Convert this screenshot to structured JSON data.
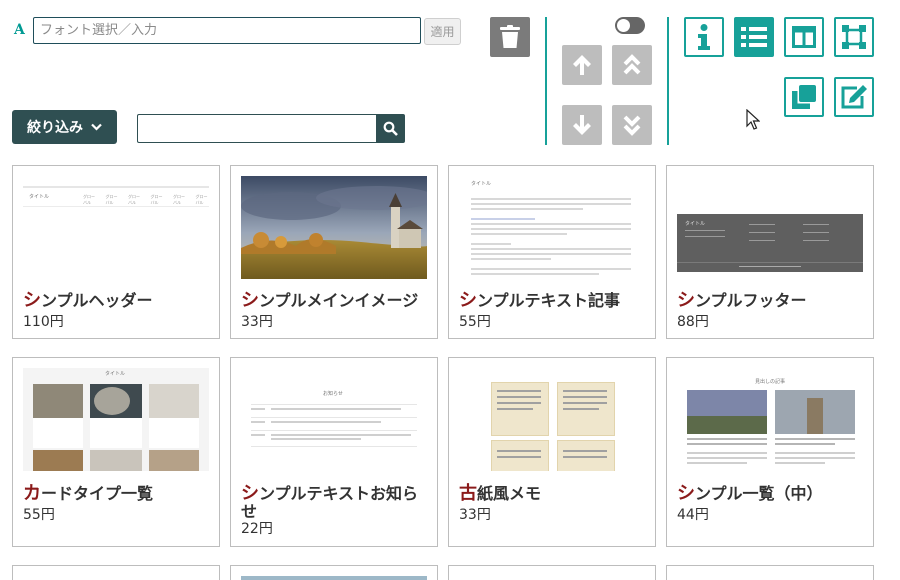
{
  "toolbar": {
    "font_icon": "A",
    "font_placeholder": "フォント選択／入力",
    "apply_label": "適用",
    "filter_label": "絞り込み",
    "search_value": ""
  },
  "icons": {
    "trash": "trash-icon",
    "up": "arrow-up-icon",
    "top": "double-chevron-up-icon",
    "down": "arrow-down-icon",
    "bottom": "double-chevron-down-icon",
    "info": "info-icon",
    "list": "list-icon",
    "columns": "columns-icon",
    "crop": "frame-icon",
    "copy": "copy-icon",
    "edit": "edit-icon",
    "search": "search-icon",
    "chevron": "chevron-down-icon"
  },
  "colors": {
    "accent": "#17a199",
    "dark": "#2f4f52",
    "title_initial": "#8b1a1a"
  },
  "cards": [
    {
      "first": "シ",
      "rest": "ンプルヘッダー",
      "price": "110円"
    },
    {
      "first": "シ",
      "rest": "ンプルメインイメージ",
      "price": "33円"
    },
    {
      "first": "シ",
      "rest": "ンプルテキスト記事",
      "price": "55円"
    },
    {
      "first": "シ",
      "rest": "ンプルフッター",
      "price": "88円"
    },
    {
      "first": "カ",
      "rest": "ードタイプ一覧",
      "price": "55円"
    },
    {
      "first": "シ",
      "rest": "ンプルテキストお知らせ",
      "price": "22円"
    },
    {
      "first": "古",
      "rest": "紙風メモ",
      "price": "33円"
    },
    {
      "first": "シ",
      "rest": "ンプル一覧（中）",
      "price": "44円"
    }
  ],
  "thumbs": {
    "header_title": "タイトル",
    "header_nav": [
      "グローバル",
      "グローバル",
      "グローバル",
      "グローバル",
      "グローバル",
      "グローバル"
    ],
    "article_title": "タイトル",
    "footer_title": "タイトル",
    "cards_title": "タイトル",
    "news_title": "お知らせ",
    "list_title": "見出しの記事"
  }
}
